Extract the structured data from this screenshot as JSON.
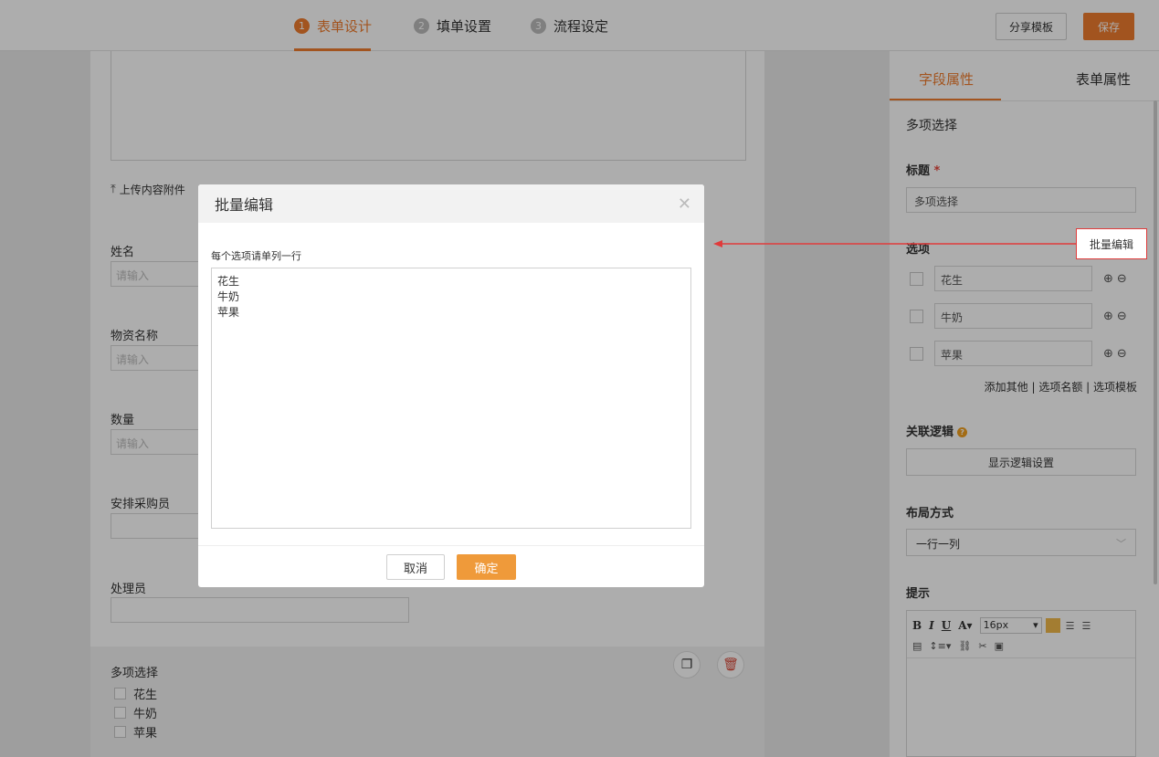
{
  "topbar": {
    "steps": [
      {
        "num": "1",
        "label": "表单设计"
      },
      {
        "num": "2",
        "label": "填单设置"
      },
      {
        "num": "3",
        "label": "流程设定"
      }
    ],
    "share_label": "分享模板",
    "save_label": "保存"
  },
  "form": {
    "upload_label": "上传内容附件",
    "fields": [
      {
        "label": "姓名",
        "placeholder": "请输入"
      },
      {
        "label": "物资名称",
        "placeholder": "请输入"
      },
      {
        "label": "数量",
        "placeholder": "请输入"
      },
      {
        "label": "安排采购员"
      },
      {
        "label": "处理员"
      }
    ],
    "multi": {
      "title": "多项选择",
      "options": [
        "花生",
        "牛奶",
        "苹果"
      ]
    }
  },
  "panel": {
    "tabs": [
      "字段属性",
      "表单属性"
    ],
    "field_type": "多项选择",
    "title_label": "标题",
    "required_mark": "*",
    "title_value": "多项选择",
    "options_label": "选项",
    "batch_edit_label": "批量编辑",
    "options": [
      "花生",
      "牛奶",
      "苹果"
    ],
    "option_links": "添加其他 | 选项名额 | 选项模板",
    "logic_label": "关联逻辑",
    "logic_button": "显示逻辑设置",
    "layout_label": "布局方式",
    "layout_value": "一行一列",
    "hint_label": "提示",
    "editor_font_size": "16px"
  },
  "modal": {
    "title": "批量编辑",
    "hint": "每个选项请单列一行",
    "lines": [
      "花生",
      "牛奶",
      "苹果"
    ],
    "cancel_label": "取消",
    "ok_label": "确定"
  },
  "colors": {
    "accent": "#ef7d2e",
    "annotation_red": "#e03b3b"
  }
}
